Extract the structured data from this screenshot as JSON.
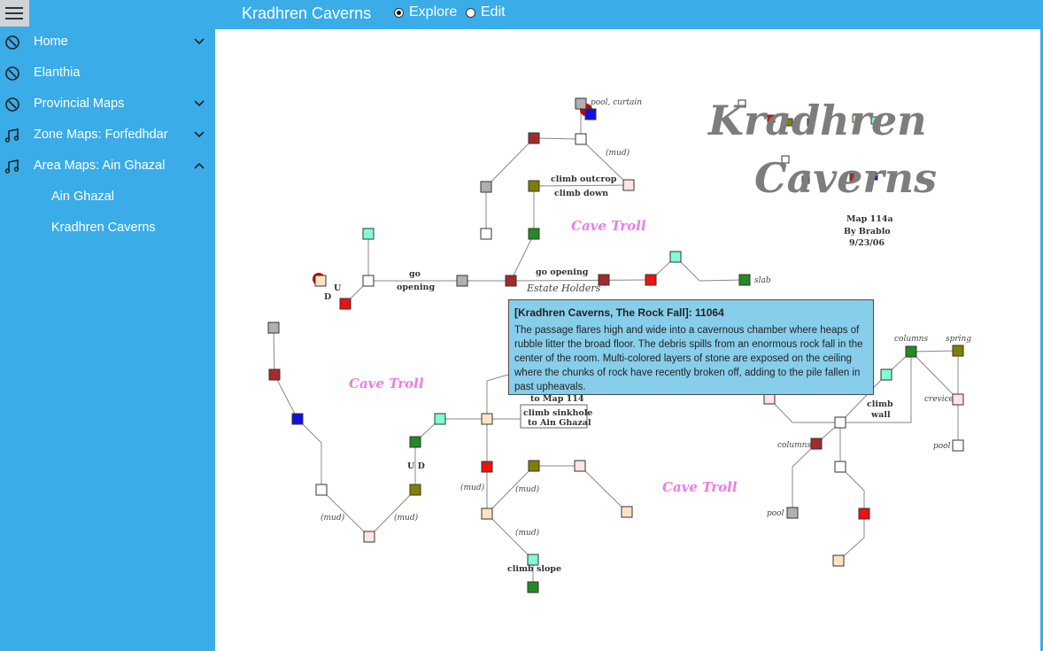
{
  "app": {
    "title": "Kradhren Caverns"
  },
  "mode": {
    "explore_label": "Explore",
    "edit_label": "Edit",
    "selected": "Explore"
  },
  "sidebar": {
    "items": [
      {
        "label": "Home",
        "icon": "compass-icon",
        "expandable": true,
        "expanded": false
      },
      {
        "label": "Elanthia",
        "icon": "compass-icon",
        "expandable": false
      },
      {
        "label": "Provincial Maps",
        "icon": "compass-icon",
        "expandable": true,
        "expanded": false
      },
      {
        "label": "Zone Maps: Forfedhdar",
        "icon": "music-note-icon",
        "expandable": true,
        "expanded": false
      },
      {
        "label": "Area Maps: Ain Ghazal",
        "icon": "music-note-icon",
        "expandable": true,
        "expanded": true
      }
    ],
    "subitems": [
      {
        "label": "Ain Ghazal"
      },
      {
        "label": "Kradhren Caverns"
      }
    ]
  },
  "map": {
    "heading_line1": "Kradhren",
    "heading_line2": "Caverns",
    "info": {
      "map_no": "Map 114a",
      "author": "By Brablo",
      "date": "9/23/06"
    },
    "labels": {
      "pool_curtain": "pool, curtain",
      "mud": "(mud)",
      "climb_outcrop": "climb outcrop",
      "climb_down": "climb down",
      "cave_troll": "Cave Troll",
      "go": "go",
      "opening": "opening",
      "go_opening": "go  opening",
      "estate": "Estate Holders",
      "slab": "slab",
      "u": "U",
      "d": "D",
      "ud": "U D",
      "to_map": "to Map 114",
      "climb_sinkhole": "climb sinkhole",
      "to_ain_ghazal": "to Ain Ghazal",
      "columns": "columns",
      "spring": "spring",
      "crevice": "crevice",
      "climb": "climb",
      "wall": "wall",
      "pool": "pool",
      "climb_slope": "climb  slope"
    }
  },
  "tooltip": {
    "title": "[Kradhren Caverns, The Rock Fall]: 11064",
    "body": "The passage flares high and wide into a cavernous chamber where heaps of rubble litter the broad floor.  The debris spills from an enormous rock fall in the center of the room.  Multi-colored layers of stone are exposed on the ceiling where the chunks of rock have recently broken off, adding to the pile fallen in past upheavals."
  },
  "colors": {
    "accent": "#3aace8",
    "tooltip_bg": "#87ceeb",
    "room_red": "#ee1111",
    "room_darkred": "#a52a2a",
    "room_green": "#228b22",
    "room_olive": "#808000",
    "room_aqua": "#7fffd4",
    "room_peach": "#ffe4c4",
    "room_pink": "#ffe4e1",
    "room_grey": "#b0b0b0",
    "room_blue": "#1111dd",
    "troll_pink": "#f07ae8"
  }
}
